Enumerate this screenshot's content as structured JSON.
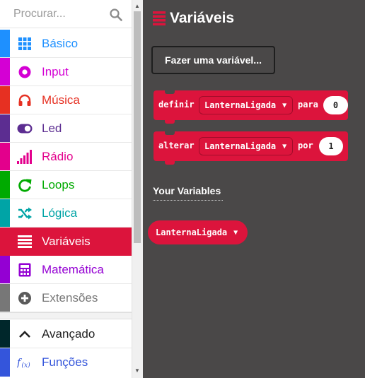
{
  "search": {
    "placeholder": "Procurar...",
    "icon": "search-icon"
  },
  "categories": [
    {
      "label": "Básico",
      "color": "#1e90ff",
      "icon": "grid-icon"
    },
    {
      "label": "Input",
      "color": "#d400d4",
      "icon": "input-circle-icon"
    },
    {
      "label": "Música",
      "color": "#e63022",
      "icon": "headphones-icon"
    },
    {
      "label": "Led",
      "color": "#5c2d91",
      "icon": "toggle-icon"
    },
    {
      "label": "Rádio",
      "color": "#e3008c",
      "icon": "signal-bars-icon"
    },
    {
      "label": "Loops",
      "color": "#00aa00",
      "icon": "refresh-icon"
    },
    {
      "label": "Lógica",
      "color": "#00a4a6",
      "icon": "shuffle-icon"
    },
    {
      "label": "Variáveis",
      "color": "#dc143c",
      "icon": "list-lines-icon",
      "selected": true
    },
    {
      "label": "Matemática",
      "color": "#9400d3",
      "icon": "calculator-icon"
    },
    {
      "label": "Extensões",
      "color": "#777777",
      "icon": "plus-circle-icon"
    }
  ],
  "advanced": [
    {
      "label": "Avançado",
      "color": "#00272b",
      "icon": "chevron-up-icon"
    },
    {
      "label": "Funções",
      "color": "#3455db",
      "icon": "function-icon"
    }
  ],
  "flyout": {
    "title": "Variáveis",
    "make_variable_button": "Fazer uma variável...",
    "blocks": [
      {
        "keyword": "definir",
        "variable": "LanternaLigada",
        "connector": "para",
        "value": "0"
      },
      {
        "keyword": "alterar",
        "variable": "LanternaLigada",
        "connector": "por",
        "value": "1"
      }
    ],
    "section_label": "Your Variables",
    "variable_pill": "LanternaLigada"
  },
  "colors": {
    "accent": "#dc143c",
    "flyout_bg": "#4a4848"
  }
}
